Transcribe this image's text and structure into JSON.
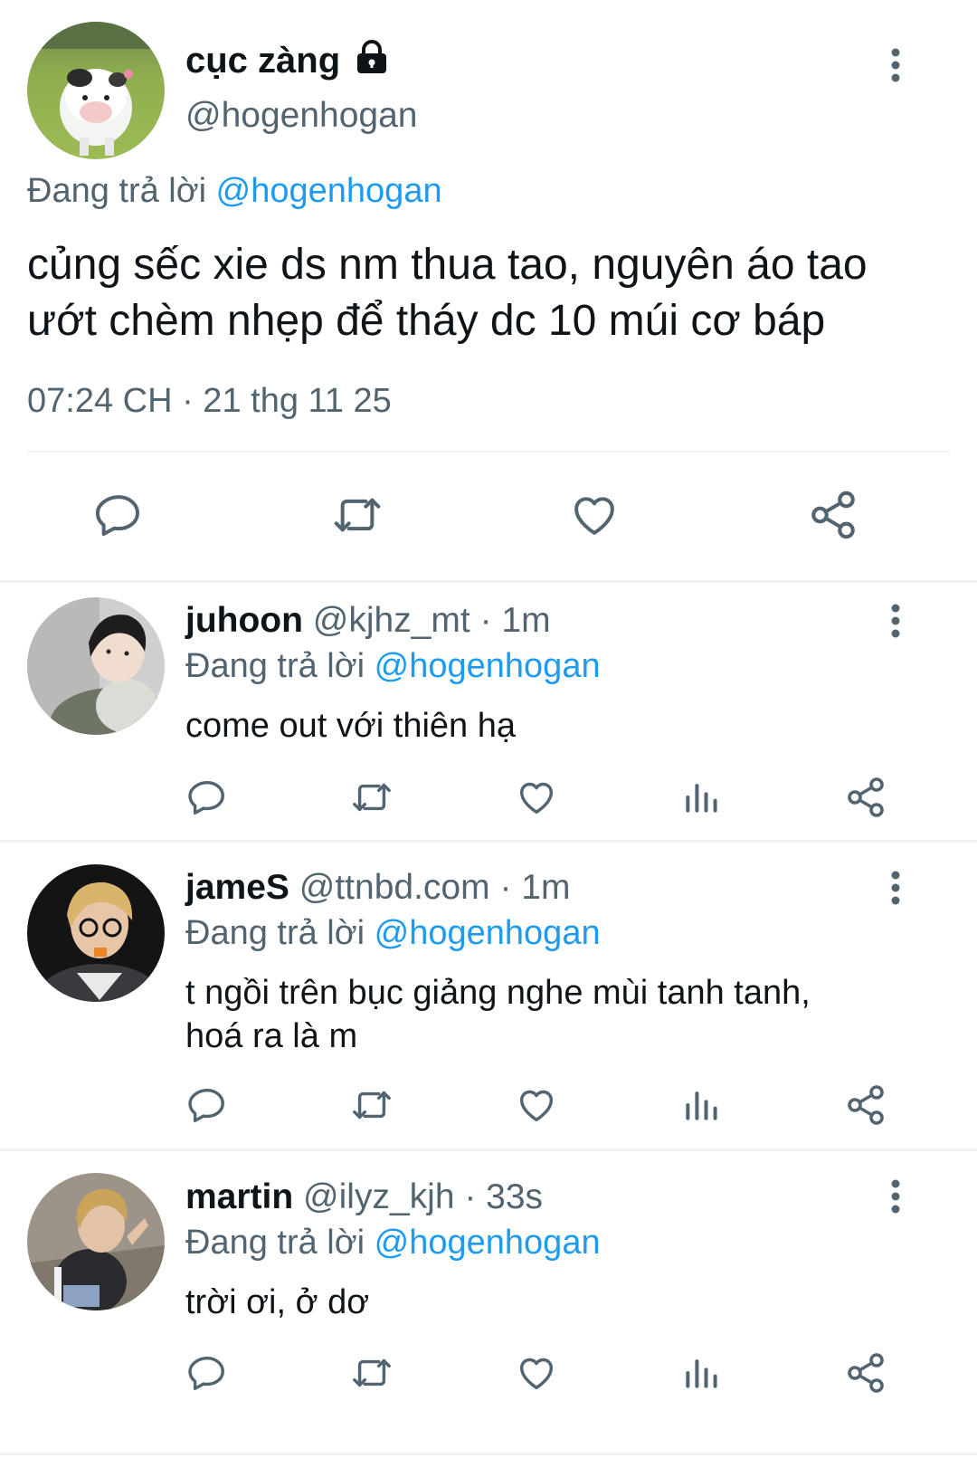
{
  "main_tweet": {
    "display_name": "cục zàng",
    "handle": "@hogenhogan",
    "replying_prefix": "Đang trả lời",
    "replying_to": "@hogenhogan",
    "text_line1": "củng sếc xie ds nm thua tao, nguyên áo tao",
    "text_line2": "ướt chèm nhẹp để tháy dc 10 múi cơ báp",
    "timestamp": "07:24 CH · 21 thg 11 25",
    "icons": [
      "reply-icon",
      "retweet-icon",
      "like-icon",
      "share-icon"
    ]
  },
  "replies": [
    {
      "display_name": "juhoon",
      "handle": "@kjhz_mt",
      "time": "· 1m",
      "replying_prefix": "Đang trả lời",
      "replying_to": "@hogenhogan",
      "text_line1": "come out với thiên hạ",
      "text_line2": ""
    },
    {
      "display_name": "jameS",
      "handle": "@ttnbd.com",
      "time": "· 1m",
      "replying_prefix": "Đang trả lời",
      "replying_to": "@hogenhogan",
      "text_line1": "t ngồi trên bục giảng nghe mùi tanh tanh,",
      "text_line2": "hoá ra là m"
    },
    {
      "display_name": "martin",
      "handle": "@ilyz_kjh",
      "time": "· 33s",
      "replying_prefix": "Đang trả lời",
      "replying_to": "@hogenhogan",
      "text_line1": "trời ơi, ở dơ",
      "text_line2": ""
    }
  ],
  "colors": {
    "text": "#0f1419",
    "muted": "#536471",
    "link": "#1d9bf0",
    "divider": "#eff3f4"
  }
}
